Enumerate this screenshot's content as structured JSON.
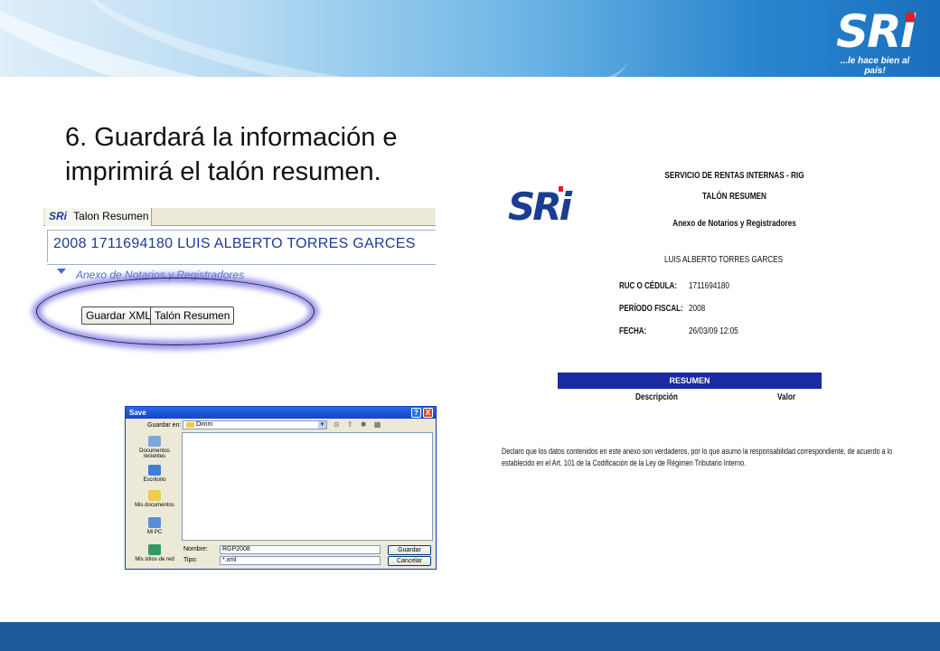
{
  "header": {
    "logo_text": "SRi",
    "tagline": "...le hace bien al país!"
  },
  "slide": {
    "heading_line1": "6.  Guardará la información e",
    "heading_line2": "imprimirá el talón resumen."
  },
  "app": {
    "tab_logo": "SRi",
    "tab_label": "Talon Resumen",
    "title": "2008 1711694180 LUIS ALBERTO TORRES GARCES",
    "section_label": "Anexo de Notarios y Registradores",
    "buttons": {
      "save_xml": "Guardar XML",
      "talon_resumen": "Talón Resumen"
    }
  },
  "save_dialog": {
    "title": "Save",
    "help_glyph": "?",
    "close_glyph": "X",
    "save_in_label": "Guardar en:",
    "save_in_value": "Dimm",
    "toolbar_glyphs": "⊙ ⇧ ✱ ▦",
    "places": [
      {
        "label": "Documentos recientes",
        "icon": "recent-documents-icon"
      },
      {
        "label": "Escritorio",
        "icon": "desktop-icon"
      },
      {
        "label": "Mis documentos",
        "icon": "my-documents-icon"
      },
      {
        "label": "Mi PC",
        "icon": "my-computer-icon"
      },
      {
        "label": "Mis sitios de red",
        "icon": "network-places-icon"
      }
    ],
    "name_label": "Nombre:",
    "name_value": "RGP2008",
    "type_label": "Tipo:",
    "type_value": "*.xml",
    "save_button": "Guardar",
    "cancel_button": "Cancelar",
    "combo_arrow": "▼"
  },
  "report": {
    "logo_text": "SRi",
    "org": "SERVICIO DE RENTAS INTERNAS - RIG",
    "doc_title": "TALÓN RESUMEN",
    "subtitle": "Anexo de Notarios y Registradores",
    "taxpayer": "LUIS ALBERTO TORRES GARCES",
    "fields": {
      "ruc_label": "RUC O CÉDULA:",
      "ruc_value": "1711694180",
      "period_label": "PERÍODO FISCAL:",
      "period_value": "2008",
      "date_label": "FECHA:",
      "date_value": "26/03/09 12:05"
    },
    "summary_bar": "RESUMEN",
    "col_description": "Descripción",
    "col_value": "Valor",
    "declaration": "Declaro que los datos contenidos en este anexo son verdaderos, por lo que asumo la responsabilidad correspondiente, de acuerdo a lo establecido en el Art. 101 de la Codificación de la Ley de Régimen Tributario Interno."
  },
  "colors": {
    "brand_blue": "#1b3d91",
    "brand_red": "#e2201b",
    "footer_blue": "#1f5a9c",
    "highlight": "#7d78e6"
  }
}
